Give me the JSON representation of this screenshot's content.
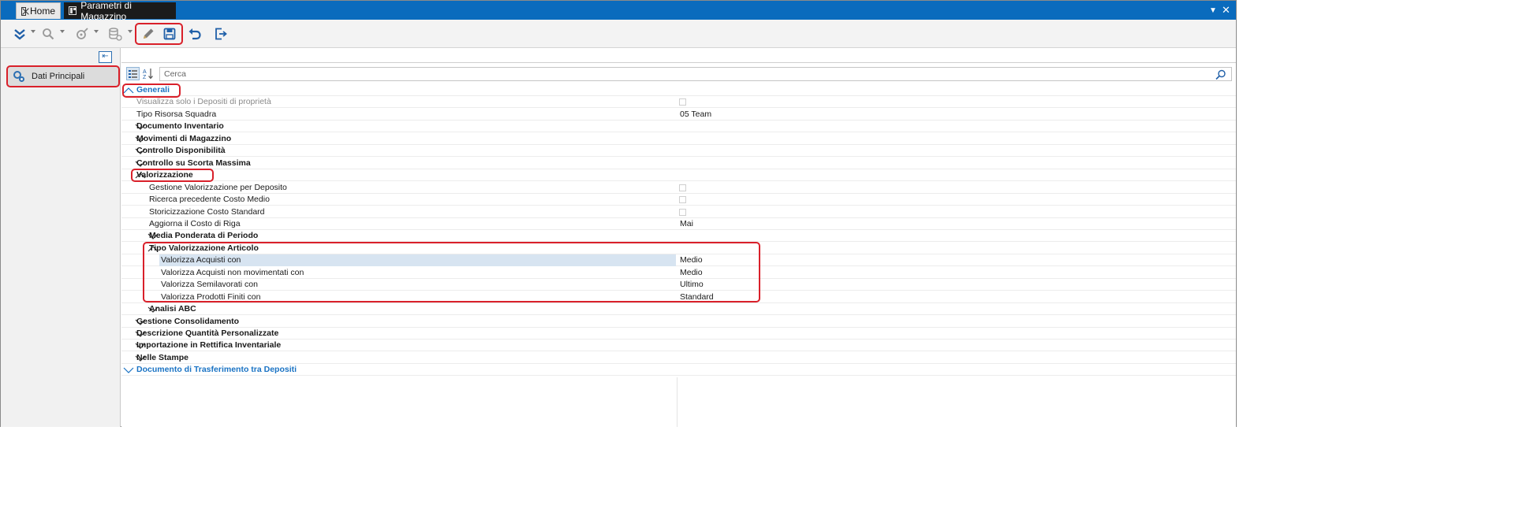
{
  "tabs": {
    "home_label": "Home",
    "active_label": "Parametri di Magazzino"
  },
  "sidebar": {
    "item_label": "Dati Principali"
  },
  "search": {
    "placeholder": "Cerca"
  },
  "icons": {
    "toolbar": [
      "expand-all-icon",
      "search-icon",
      "wizard-icon",
      "database-icon",
      "edit-pencil-icon",
      "save-icon",
      "undo-icon",
      "exit-icon"
    ],
    "collapse": "collapse-panel-icon",
    "categorized": "categorized-view-icon",
    "alphabetical": "alphabetical-sort-icon"
  },
  "colors": {
    "tabstrip": "#0a6bbd",
    "accent": "#1a73c4",
    "highlight": "#d9202a",
    "selection": "#d7e4f1"
  },
  "properties": [
    {
      "label": "Generali",
      "value": "",
      "indent": 0,
      "kind": "section",
      "expanded": true
    },
    {
      "label": "Visualizza solo i Depositi di proprietà",
      "value": "",
      "indent": 1,
      "kind": "checkbox",
      "disabled": true
    },
    {
      "label": "Tipo Risorsa Squadra",
      "value": "05 Team",
      "indent": 1,
      "kind": "prop"
    },
    {
      "label": "Documento Inventario",
      "value": "",
      "indent": 1,
      "kind": "cat",
      "expanded": false
    },
    {
      "label": "Movimenti di Magazzino",
      "value": "",
      "indent": 1,
      "kind": "cat",
      "expanded": false
    },
    {
      "label": "Controllo Disponibilità",
      "value": "",
      "indent": 1,
      "kind": "cat",
      "expanded": false
    },
    {
      "label": "Controllo su Scorta Massima",
      "value": "",
      "indent": 1,
      "kind": "cat",
      "expanded": false
    },
    {
      "label": "Valorizzazione",
      "value": "",
      "indent": 1,
      "kind": "cat",
      "expanded": true
    },
    {
      "label": "Gestione Valorizzazione per Deposito",
      "value": "",
      "indent": 2,
      "kind": "checkbox"
    },
    {
      "label": "Ricerca precedente Costo Medio",
      "value": "",
      "indent": 2,
      "kind": "checkbox"
    },
    {
      "label": "Storicizzazione Costo Standard",
      "value": "",
      "indent": 2,
      "kind": "checkbox"
    },
    {
      "label": "Aggiorna il Costo di Riga",
      "value": "Mai",
      "indent": 2,
      "kind": "prop"
    },
    {
      "label": "Media Ponderata di Periodo",
      "value": "",
      "indent": 2,
      "kind": "cat",
      "expanded": false
    },
    {
      "label": "Tipo Valorizzazione Articolo",
      "value": "",
      "indent": 2,
      "kind": "cat",
      "expanded": true
    },
    {
      "label": "Valorizza Acquisti con",
      "value": "Medio",
      "indent": 3,
      "kind": "prop",
      "selected": true
    },
    {
      "label": "Valorizza Acquisti non movimentati con",
      "value": "Medio",
      "indent": 3,
      "kind": "prop"
    },
    {
      "label": "Valorizza Semilavorati con",
      "value": "Ultimo",
      "indent": 3,
      "kind": "prop"
    },
    {
      "label": "Valorizza Prodotti Finiti con",
      "value": "Standard",
      "indent": 3,
      "kind": "prop"
    },
    {
      "label": "Analisi ABC",
      "value": "",
      "indent": 2,
      "kind": "cat",
      "expanded": false
    },
    {
      "label": "Gestione Consolidamento",
      "value": "",
      "indent": 1,
      "kind": "cat",
      "expanded": false
    },
    {
      "label": "Descrizione Quantità Personalizzate",
      "value": "",
      "indent": 1,
      "kind": "cat",
      "expanded": false
    },
    {
      "label": "Importazione in Rettifica Inventariale",
      "value": "",
      "indent": 1,
      "kind": "cat",
      "expanded": false
    },
    {
      "label": "Nelle Stampe",
      "value": "",
      "indent": 1,
      "kind": "cat",
      "expanded": false
    },
    {
      "label": "Documento di Trasferimento tra Depositi",
      "value": "",
      "indent": 0,
      "kind": "section",
      "expanded": false
    }
  ]
}
